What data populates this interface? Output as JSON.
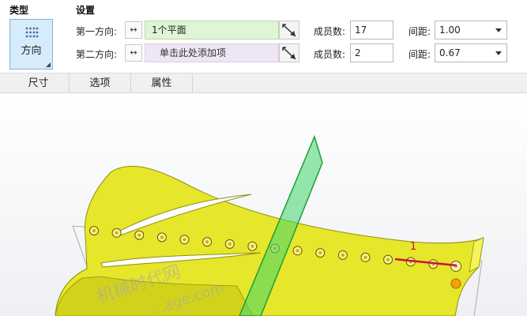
{
  "type_section": {
    "title": "类型",
    "button_label": "方向"
  },
  "settings_section": {
    "title": "设置"
  },
  "direction1": {
    "label": "第一方向:",
    "arrows": "↔",
    "collector": "1个平面"
  },
  "direction2": {
    "label": "第二方向:",
    "arrows": "↔",
    "collector": "单击此处添加项"
  },
  "members1": {
    "label": "成员数:",
    "value": "17"
  },
  "members2": {
    "label": "成员数:",
    "value": "2"
  },
  "spacing1": {
    "label": "间距:",
    "value": "1.00"
  },
  "spacing2": {
    "label": "间距:",
    "value": "0.67"
  },
  "tabs": [
    {
      "label": "尺寸"
    },
    {
      "label": "选项"
    },
    {
      "label": "属性"
    }
  ],
  "viewport": {
    "pattern_index_label": "1",
    "hole_count": 17
  },
  "watermark": {
    "line1": "机械时代网",
    "line2": "...age.com"
  },
  "colors": {
    "part_yellow": "#e6e62a",
    "part_shadow": "#b8b816",
    "hole_fill": "#d8a410",
    "plane_green": "#3fd66a",
    "active_collector": "#dff5d6",
    "empty_collector": "#efe6f5",
    "type_selected": "#d6ecfb"
  }
}
